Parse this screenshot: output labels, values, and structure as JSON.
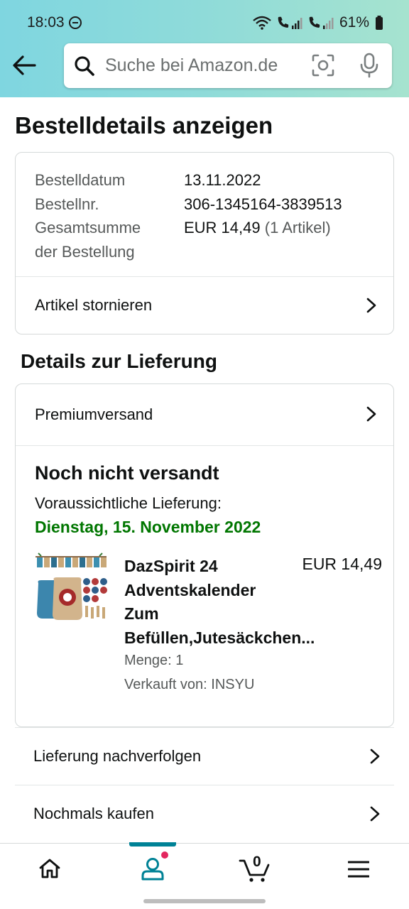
{
  "status_bar": {
    "time": "18:03",
    "battery": "61%",
    "icons": [
      "do-not-disturb-icon",
      "wifi-icon",
      "volte-sim1-icon",
      "volte-sim2-icon",
      "battery-icon"
    ]
  },
  "header": {
    "search_placeholder": "Suche bei Amazon.de",
    "back_icon": "back-arrow-icon",
    "camera_icon": "camera-scan-icon",
    "mic_icon": "microphone-icon"
  },
  "page": {
    "title": "Bestelldetails anzeigen"
  },
  "order_summary": {
    "date_label": "Bestelldatum",
    "date_value": "13.11.2022",
    "number_label": "Bestellnr.",
    "number_value": "306-1345164-3839513",
    "total_label_line1": "Gesamtsumme",
    "total_label_line2": "der Bestellung",
    "total_value": "EUR 14,49",
    "total_items": "(1 Artikel)",
    "cancel_label": "Artikel stornieren"
  },
  "delivery": {
    "section_title": "Details zur Lieferung",
    "shipping_method": "Premiumversand",
    "status": "Noch nicht versandt",
    "eta_label": "Voraussichtliche Lieferung:",
    "eta_date": "Dienstag, 15. November 2022",
    "product": {
      "name_lines": [
        "DazSpirit 24",
        "Adventskalender",
        "Zum",
        "Befüllen,Jutesäckchen..."
      ],
      "price": "EUR 14,49",
      "quantity": "Menge: 1",
      "seller": "Verkauft von: INSYU"
    }
  },
  "actions": {
    "track": "Lieferung nachverfolgen",
    "buy_again": "Nochmals kaufen"
  },
  "bottom_nav": {
    "cart_count": "0",
    "items": [
      "home-icon",
      "account-icon",
      "cart-icon",
      "menu-icon"
    ]
  },
  "colors": {
    "header_gradient_start": "#7fd6e0",
    "header_gradient_end": "#a6e3cf",
    "eta_green": "#007600",
    "nav_active": "#008296",
    "notification_dot": "#e3275f"
  }
}
